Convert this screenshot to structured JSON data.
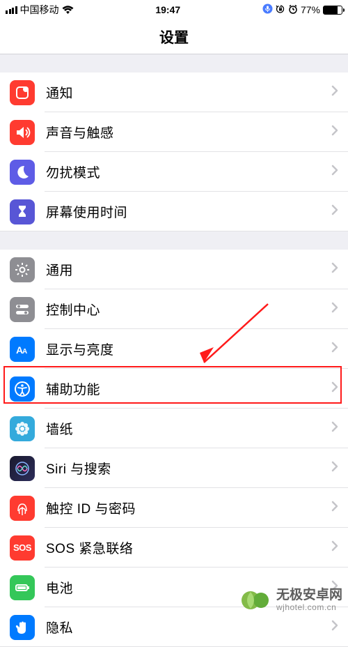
{
  "status_bar": {
    "carrier": "中国移动",
    "time": "19:47",
    "battery_percent": "77%"
  },
  "page_title": "设置",
  "groups": [
    {
      "items": [
        {
          "id": "notifications",
          "label": "通知",
          "icon": "notification-badge",
          "color": "ic-red"
        },
        {
          "id": "sounds",
          "label": "声音与触感",
          "icon": "speaker",
          "color": "ic-red"
        },
        {
          "id": "dnd",
          "label": "勿扰模式",
          "icon": "moon",
          "color": "ic-purple"
        },
        {
          "id": "screentime",
          "label": "屏幕使用时间",
          "icon": "hourglass",
          "color": "ic-indigo"
        }
      ]
    },
    {
      "items": [
        {
          "id": "general",
          "label": "通用",
          "icon": "gear",
          "color": "ic-gray"
        },
        {
          "id": "control-center",
          "label": "控制中心",
          "icon": "switches",
          "color": "ic-gray"
        },
        {
          "id": "display",
          "label": "显示与亮度",
          "icon": "text-size",
          "color": "ic-blue"
        },
        {
          "id": "accessibility",
          "label": "辅助功能",
          "icon": "accessibility",
          "color": "ic-blue",
          "highlighted": true
        },
        {
          "id": "wallpaper",
          "label": "墙纸",
          "icon": "flower",
          "color": "ic-teal"
        },
        {
          "id": "siri",
          "label": "Siri 与搜索",
          "icon": "siri",
          "color": "ic-siri"
        },
        {
          "id": "touchid",
          "label": "触控 ID 与密码",
          "icon": "fingerprint",
          "color": "ic-red"
        },
        {
          "id": "sos",
          "label": "SOS 紧急联络",
          "icon": "sos",
          "color": "ic-red"
        },
        {
          "id": "battery",
          "label": "电池",
          "icon": "battery",
          "color": "ic-green"
        },
        {
          "id": "privacy",
          "label": "隐私",
          "icon": "hand",
          "color": "ic-blue"
        }
      ]
    }
  ],
  "watermark": {
    "title": "无极安卓网",
    "subtitle": "wjhotel.com.cn"
  }
}
